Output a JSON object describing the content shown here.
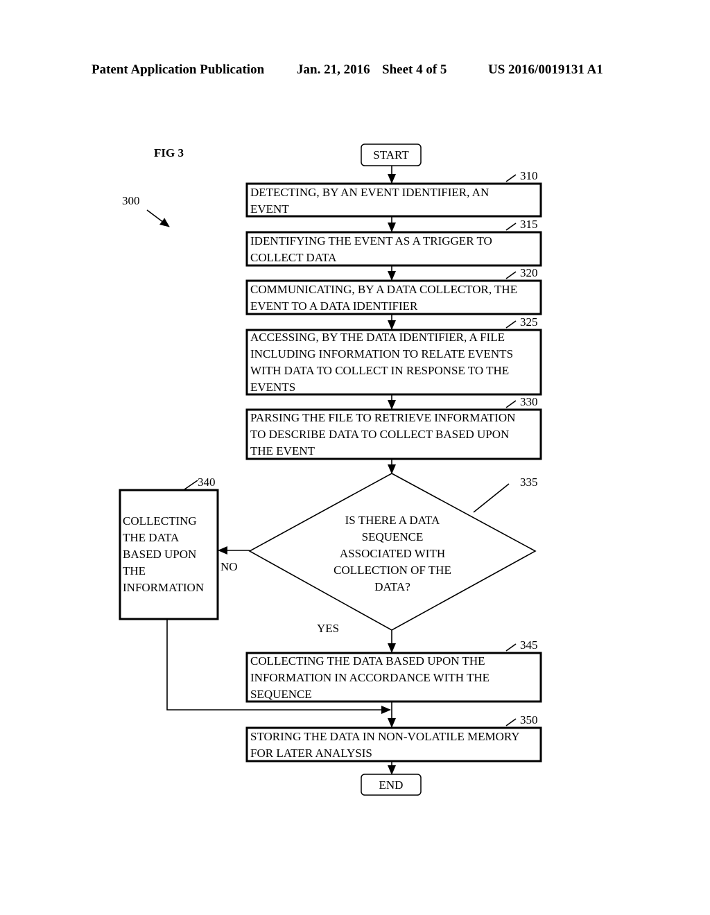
{
  "header": {
    "publication": "Patent Application Publication",
    "date": "Jan. 21, 2016",
    "sheet": "Sheet 4 of 5",
    "number": "US 2016/0019131 A1"
  },
  "figure": {
    "label": "FIG 3",
    "ref": "300"
  },
  "flow": {
    "start": "START",
    "end": "END",
    "steps": [
      {
        "ref": "310",
        "lines": [
          "DETECTING, BY AN EVENT IDENTIFIER, AN",
          "EVENT"
        ]
      },
      {
        "ref": "315",
        "lines": [
          "IDENTIFYING THE EVENT AS A TRIGGER TO",
          "COLLECT DATA"
        ]
      },
      {
        "ref": "320",
        "lines": [
          "COMMUNICATING, BY A DATA COLLECTOR, THE",
          "EVENT TO A DATA IDENTIFIER"
        ]
      },
      {
        "ref": "325",
        "lines": [
          "ACCESSING, BY THE DATA IDENTIFIER, A FILE",
          "INCLUDING INFORMATION TO RELATE EVENTS",
          "WITH DATA TO COLLECT IN RESPONSE TO THE",
          "EVENTS"
        ]
      },
      {
        "ref": "330",
        "lines": [
          "PARSING THE FILE TO RETRIEVE INFORMATION",
          "TO DESCRIBE DATA TO COLLECT BASED UPON",
          "THE EVENT"
        ]
      },
      {
        "ref": "345",
        "lines": [
          "COLLECTING THE DATA BASED UPON THE",
          "INFORMATION IN ACCORDANCE WITH THE",
          "SEQUENCE"
        ]
      },
      {
        "ref": "350",
        "lines": [
          "STORING THE DATA IN NON-VOLATILE MEMORY",
          "FOR LATER ANALYSIS"
        ]
      }
    ],
    "decision": {
      "ref": "335",
      "lines": [
        "IS THERE A DATA",
        "SEQUENCE",
        "ASSOCIATED WITH",
        "COLLECTION OF THE",
        "DATA?"
      ],
      "no_label": "NO",
      "yes_label": "YES"
    },
    "side_step": {
      "ref": "340",
      "lines": [
        "COLLECTING",
        "THE DATA",
        "BASED UPON",
        "THE",
        "INFORMATION"
      ]
    }
  }
}
